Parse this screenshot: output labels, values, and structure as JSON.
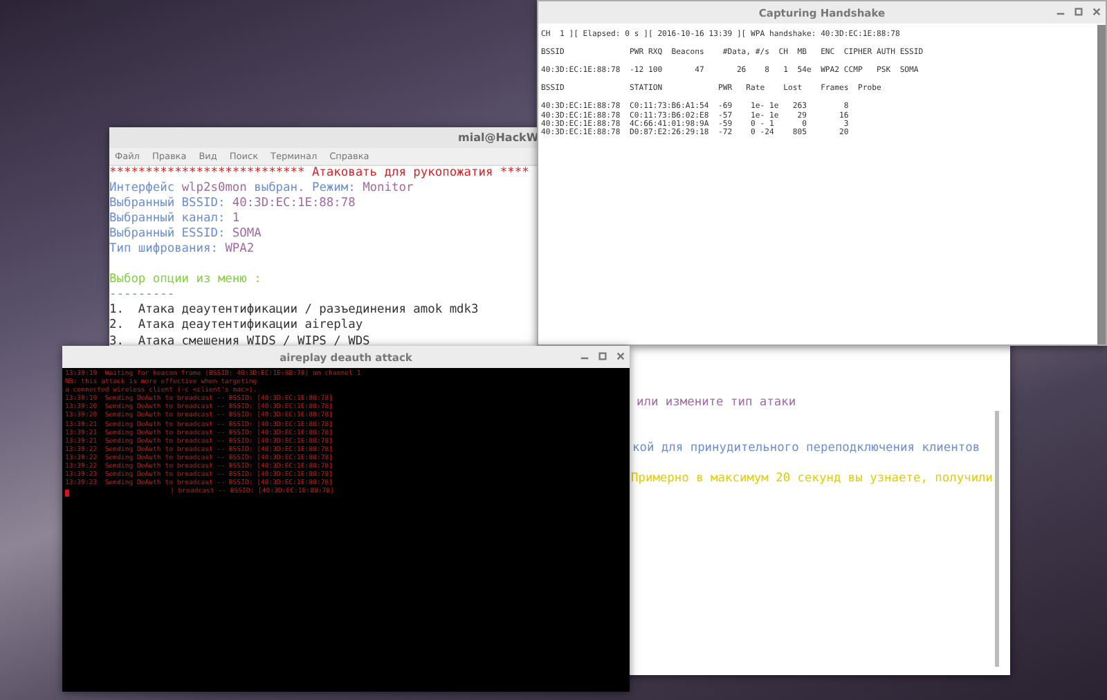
{
  "terminal": {
    "title": "mial@HackW",
    "menu": [
      "Файл",
      "Правка",
      "Вид",
      "Поиск",
      "Терминал",
      "Справка"
    ],
    "lines": [
      {
        "segments": [
          {
            "text": "*************************** Атаковать для рукопожатия ****",
            "color": "#e02020"
          }
        ]
      },
      {
        "segments": [
          {
            "text": "Интерфейс ",
            "color": "#6b8fd6"
          },
          {
            "text": "wlp2s0mon",
            "color": "#a46aa4"
          },
          {
            "text": " выбран. Режим: ",
            "color": "#6b8fd6"
          },
          {
            "text": "Monitor",
            "color": "#a46aa4"
          }
        ]
      },
      {
        "segments": [
          {
            "text": "Выбранный BSSID: ",
            "color": "#6b8fd6"
          },
          {
            "text": "40:3D:EC:1E:88:78",
            "color": "#a46aa4"
          }
        ]
      },
      {
        "segments": [
          {
            "text": "Выбранный канал: ",
            "color": "#6b8fd6"
          },
          {
            "text": "1",
            "color": "#a46aa4"
          }
        ]
      },
      {
        "segments": [
          {
            "text": "Выбранный ESSID: ",
            "color": "#6b8fd6"
          },
          {
            "text": "SOMA",
            "color": "#a46aa4"
          }
        ]
      },
      {
        "segments": [
          {
            "text": "Тип шифрования: ",
            "color": "#6b8fd6"
          },
          {
            "text": "WPA2",
            "color": "#a46aa4"
          }
        ]
      },
      {
        "segments": [
          {
            "text": "Выбор опции из меню :",
            "color": "#7fd43a"
          }
        ]
      },
      {
        "segments": [
          {
            "text": "---------",
            "color": "#6b8fd6"
          }
        ]
      },
      {
        "segments": [
          {
            "text": "1.  Атака деаутентификации / разъединения amok mdk3",
            "color": "#333333"
          }
        ]
      },
      {
        "segments": [
          {
            "text": "2.  Атака деаутентификации aireplay",
            "color": "#333333"
          }
        ]
      },
      {
        "segments": [
          {
            "text": "3.  Атака смешения WIDS / WIPS / WDS",
            "color": "#333333"
          }
        ]
      }
    ],
    "lines_beside_overlay": [
      {
        "text": "или измените тип атаки",
        "color": "#a46aa4"
      },
      {
        "text": "кой для принудительного переподключения клиентов",
        "color": "#6b8fd6"
      },
      {
        "text": "Примерно в максимум 20 секунд вы узнаете, получили",
        "color": "#e6cc00"
      }
    ]
  },
  "handshake_window": {
    "title": "Capturing Handshake",
    "blocks": [
      [
        "CH  1 ][ Elapsed: 0 s ][ 2016-10-16 13:39 ][ WPA handshake: 40:3D:EC:1E:88:78"
      ],
      [
        "BSSID              PWR RXQ  Beacons    #Data, #/s  CH  MB   ENC  CIPHER AUTH ESSID"
      ],
      [
        "40:3D:EC:1E:88:78  -12 100       47       26    8   1  54e  WPA2 CCMP   PSK  SOMA"
      ],
      [
        "BSSID              STATION            PWR   Rate    Lost    Frames  Probe"
      ],
      [
        "40:3D:EC:1E:88:78  C0:11:73:B6:A1:54  -69    1e- 1e   263        8",
        "40:3D:EC:1E:88:78  C0:11:73:B6:02:E8  -57    1e- 1e    29       16",
        "40:3D:EC:1E:88:78  4C:66:41:01:98:9A  -59    0 - 1      0        3",
        "40:3D:EC:1E:88:78  D0:87:E2:26:29:18  -72    0 -24    805       20"
      ]
    ]
  },
  "aireplay_window": {
    "title": "aireplay deauth attack",
    "lines": [
      {
        "kind": "text",
        "text": "13:39:19  Waiting for beacon frame (BSSID: 40:3D:EC:1E:88:78) on channel 1"
      },
      {
        "kind": "text",
        "text": "NB: this attack is more effective when targeting"
      },
      {
        "kind": "text",
        "text": "a connected wireless client (-c <client's mac>)."
      },
      {
        "kind": "text",
        "text": "13:39:19  Sending DeAuth to broadcast -- BSSID: [40:3D:EC:1E:88:78]"
      },
      {
        "kind": "text",
        "text": "13:39:20  Sending DeAuth to broadcast -- BSSID: [40:3D:EC:1E:88:78]"
      },
      {
        "kind": "text",
        "text": "13:39:20  Sending DeAuth to broadcast -- BSSID: [40:3D:EC:1E:88:78]"
      },
      {
        "kind": "text",
        "text": "13:39:21  Sending DeAuth to broadcast -- BSSID: [40:3D:EC:1E:88:78]"
      },
      {
        "kind": "text",
        "text": "13:39:21  Sending DeAuth to broadcast -- BSSID: [40:3D:EC:1E:88:78]"
      },
      {
        "kind": "text",
        "text": "13:39:21  Sending DeAuth to broadcast -- BSSID: [40:3D:EC:1E:88:78]"
      },
      {
        "kind": "text",
        "text": "13:39:22  Sending DeAuth to broadcast -- BSSID: [40:3D:EC:1E:88:78]"
      },
      {
        "kind": "text",
        "text": "13:39:22  Sending DeAuth to broadcast -- BSSID: [40:3D:EC:1E:88:78]"
      },
      {
        "kind": "text",
        "text": "13:39:22  Sending DeAuth to broadcast -- BSSID: [40:3D:EC:1E:88:78]"
      },
      {
        "kind": "text",
        "text": "13:39:23  Sending DeAuth to broadcast -- BSSID: [40:3D:EC:1E:88:78]"
      },
      {
        "kind": "text",
        "text": "13:39:23  Sending DeAuth to broadcast -- BSSID: [40:3D:EC:1E:88:78]"
      },
      {
        "kind": "cursor",
        "text": ") broadcast -- BSSID: [40:3D:EC:1E:88:78]"
      }
    ]
  }
}
